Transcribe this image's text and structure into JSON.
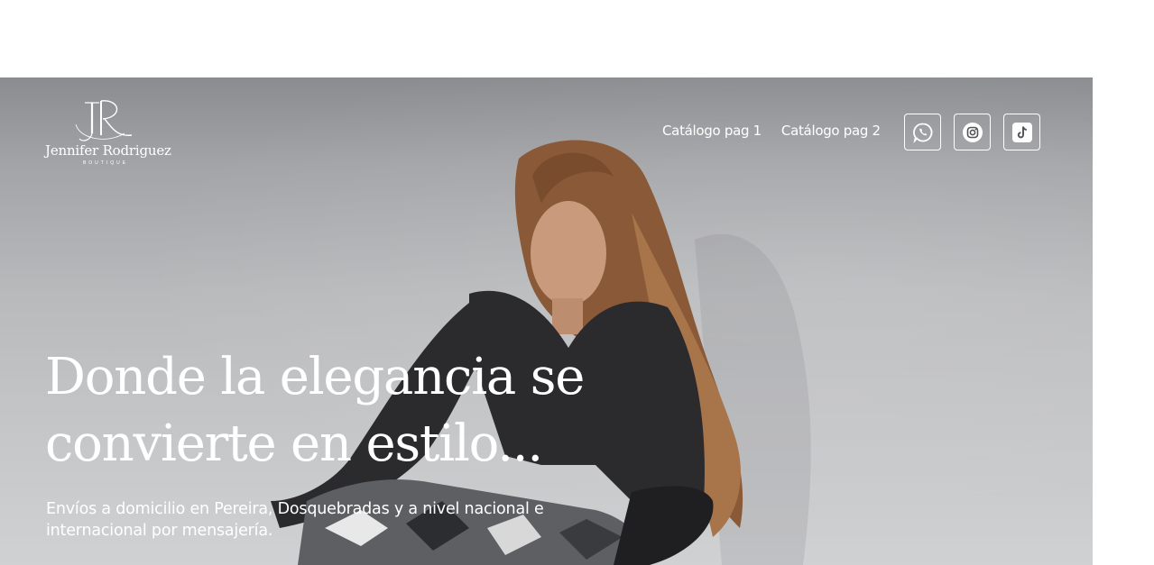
{
  "brand": {
    "monogram": "JR",
    "name": "Jennifer Rodriguez",
    "tagline": "BOUTIQUE"
  },
  "nav": {
    "items": [
      {
        "label": "Catálogo pag 1"
      },
      {
        "label": "Catálogo pag 2"
      }
    ]
  },
  "social": [
    {
      "icon": "whatsapp-icon"
    },
    {
      "icon": "instagram-icon"
    },
    {
      "icon": "tiktok-icon"
    }
  ],
  "hero": {
    "headline_line1": "Donde la elegancia se",
    "headline_line2": "convierte en estilo...",
    "subtitle_line1": "Envíos a domicilio en Pereira, Dosquebradas y a nivel nacional e",
    "subtitle_line2": "internacional por mensajería."
  },
  "colors": {
    "overlay": "#a3a4a7",
    "text": "#ffffff"
  }
}
